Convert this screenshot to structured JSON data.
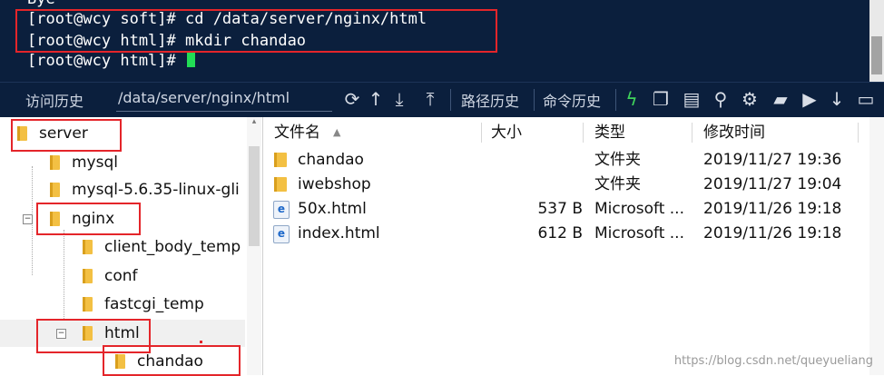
{
  "terminal": {
    "lines": [
      "[root@wcy soft]# cd /data/server/nginx/html",
      "[root@wcy html]# mkdir chandao",
      "[root@wcy html]# "
    ],
    "top_partial": "Bye"
  },
  "toolbar": {
    "history_label": "访问历史",
    "path_value": "/data/server/nginx/html",
    "path_history_label": "路径历史",
    "command_history_label": "命令历史"
  },
  "tree": {
    "items": [
      {
        "label": "server"
      },
      {
        "label": "mysql"
      },
      {
        "label": "mysql-5.6.35-linux-gli"
      },
      {
        "label": "nginx",
        "expander": "−"
      },
      {
        "label": "client_body_temp"
      },
      {
        "label": "conf"
      },
      {
        "label": "fastcgi_temp"
      },
      {
        "label": "html",
        "expander": "−"
      },
      {
        "label": "chandao"
      }
    ]
  },
  "files": {
    "columns": [
      "文件名",
      "大小",
      "类型",
      "修改时间"
    ],
    "sort_indicator": "▲",
    "rows": [
      {
        "icon": "folder-icon",
        "name": "chandao",
        "size": "",
        "type": "文件夹",
        "modified": "2019/11/27 19:36"
      },
      {
        "icon": "folder-icon",
        "name": "iwebshop",
        "size": "",
        "type": "文件夹",
        "modified": "2019/11/27 19:04"
      },
      {
        "icon": "html-file-icon",
        "name": "50x.html",
        "size": "537 B",
        "type": "Microsoft ...",
        "modified": "2019/11/26 19:18"
      },
      {
        "icon": "html-file-icon",
        "name": "index.html",
        "size": "612 B",
        "type": "Microsoft ...",
        "modified": "2019/11/26 19:18"
      }
    ]
  },
  "watermark": "https://blog.csdn.net/queyueliang",
  "colors": {
    "terminal_bg": "#0b1f3d",
    "highlight_red": "#e4252a",
    "cursor_green": "#22dd55"
  }
}
